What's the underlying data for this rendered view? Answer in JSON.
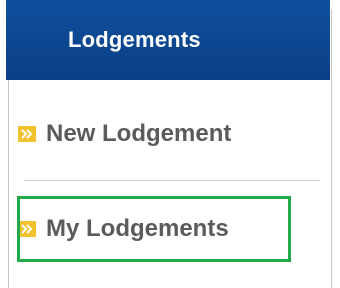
{
  "header": {
    "title": "Lodgements"
  },
  "menu": {
    "items": [
      {
        "label": "New Lodgement",
        "icon": "double-chevron-right-icon"
      },
      {
        "label": "My Lodgements",
        "icon": "double-chevron-right-icon"
      }
    ],
    "highlighted_item": "My Lodgements"
  },
  "colors": {
    "header_bg": "#0b3f86",
    "icon_bg": "#f2c12e",
    "highlight_border": "#23a84a",
    "label_text": "#5b5b5b"
  }
}
